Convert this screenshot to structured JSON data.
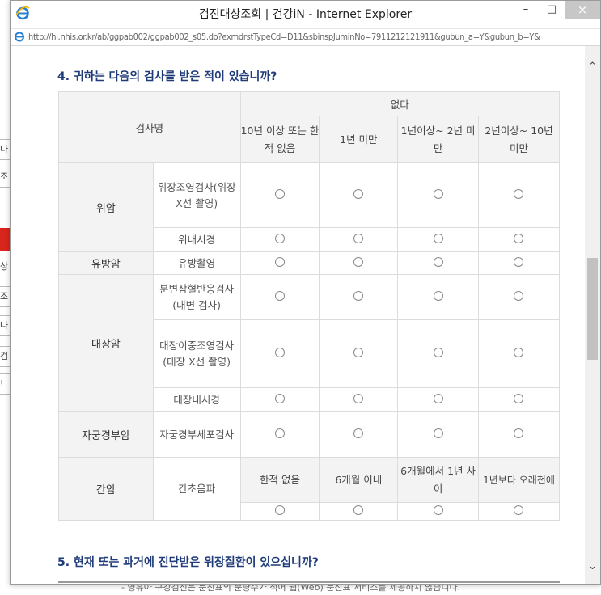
{
  "window": {
    "title": "검진대상조회 | 건강iN - Internet Explorer",
    "address": "http://hi.nhis.or.kr/ab/ggpab002/ggpab002_s05.do?exmdrstTypeCd=D11&sbinspJuminNo=7911212121911&gubun_a=Y&gubun_b=Y&",
    "buttons": {
      "minimize": "–",
      "maximize": "□",
      "close": "×"
    }
  },
  "question4": {
    "title": "4. 귀하는 다음의 검사를 받은 적이 있습니까?",
    "header": {
      "exam_name": "검사명",
      "none_group": "없다",
      "col1": "10년 이상 또는 한적 없음",
      "col2": "1년 미만",
      "col3": "1년이상~ 2년 미만",
      "col4": "2년이상~ 10년 미만"
    },
    "rows": [
      {
        "category": "위암",
        "exams": [
          "위장조영검사(위장 X선 촬영)",
          "위내시경"
        ]
      },
      {
        "category": "유방암",
        "exams": [
          "유방촬영"
        ]
      },
      {
        "category": "대장암",
        "exams": [
          "분변잠혈반응검사(대변 검사)",
          "대장이중조영검사(대장 X선 촬영)",
          "대장내시경"
        ]
      },
      {
        "category": "자궁경부암",
        "exams": [
          "자궁경부세포검사"
        ]
      }
    ],
    "liver": {
      "category": "간암",
      "exam": "간초음파",
      "col1": "한적 없음",
      "col2": "6개월 이내",
      "col3": "6개월에서 1년 사이",
      "col4": "1년보다 오래전에"
    },
    "radio_symbol": "○"
  },
  "question5": {
    "title": "5. 현재 또는 과거에 진단받은 위장질환이 있으십니까?"
  },
  "background": {
    "fragments": [
      "나",
      "조",
      "",
      "",
      "",
      "상",
      "조회",
      "나",
      "검",
      "!"
    ],
    "bottom_notice": "- 영유아 구강검진은 문진표의 분량수가 적어 웹(Web) 문진표 서비스를 제공하지 않습니다."
  },
  "colors": {
    "title_blue": "#1f3b7a",
    "header_gray": "#f3f3f3",
    "red_bar": "#d8261c"
  }
}
